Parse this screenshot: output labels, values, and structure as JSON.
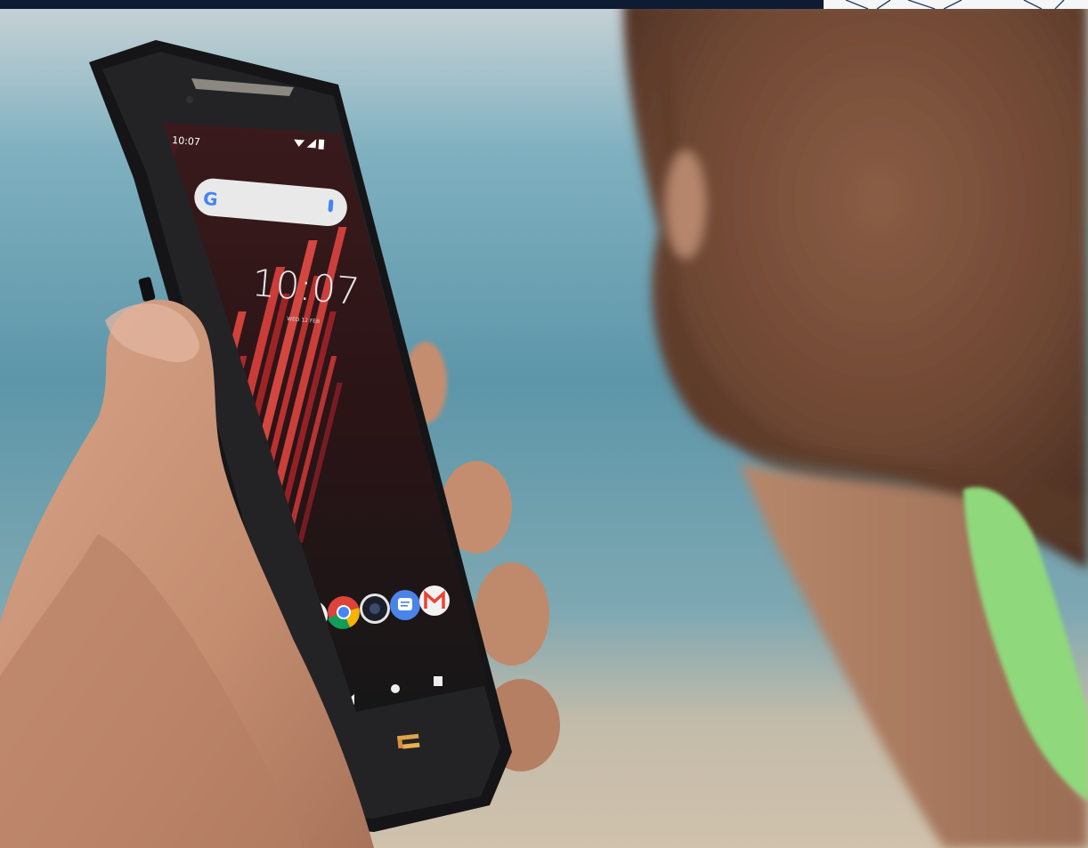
{
  "scene": {
    "description_free": true,
    "colors": {
      "brand_bar": "#0d1b33",
      "sea_blue": "#5d93a6",
      "sand": "#c8b7a0",
      "skin": "#b98566",
      "beard": "#6d4a35",
      "shirt_green": "#8fd87b",
      "phone_body": "#1a1a1c",
      "wallpaper_red": "#d63a3a"
    }
  },
  "phone": {
    "status_time": "10:07",
    "lock_time": "10:07",
    "lock_date": "WED 12 FEB",
    "search_logo": "G",
    "dock_apps": [
      {
        "icon": "phone-icon",
        "color": "#f2f2f2"
      },
      {
        "icon": "chrome-icon",
        "color": "#4285f4"
      },
      {
        "icon": "camera-icon",
        "color": "#1c1f2a"
      },
      {
        "icon": "messages-icon",
        "color": "#4a84e8"
      },
      {
        "icon": "gmail-icon",
        "color": "#f2f2f2"
      }
    ],
    "nav_icons": [
      "back-icon",
      "home-icon",
      "recents-icon"
    ],
    "brand_logo": "crosscall-logo-icon"
  }
}
